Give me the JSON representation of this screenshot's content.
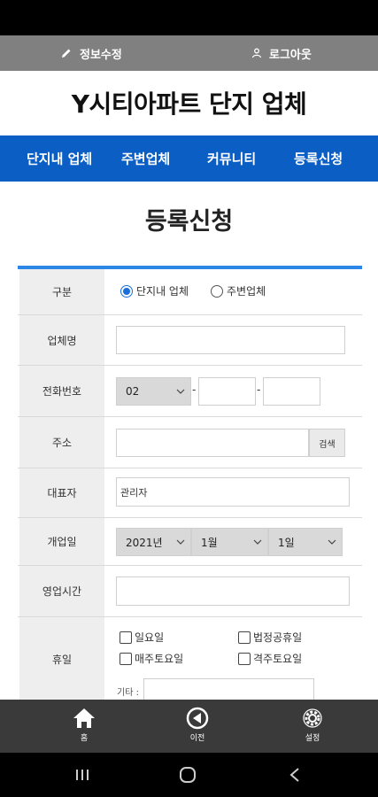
{
  "topbar": {
    "edit_label": "정보수정",
    "logout_label": "로그아웃"
  },
  "site": {
    "title": "Y시티아파트 단지 업체"
  },
  "nav": {
    "items": [
      {
        "label": "단지내 업체"
      },
      {
        "label": "주변업체"
      },
      {
        "label": "커뮤니티"
      },
      {
        "label": "등록신청"
      }
    ]
  },
  "page": {
    "title": "등록신청"
  },
  "form": {
    "category": {
      "label": "구분",
      "options": [
        "단지내 업체",
        "주변업체"
      ],
      "selected": "단지내 업체"
    },
    "company_name": {
      "label": "업체명",
      "value": ""
    },
    "phone": {
      "label": "전화번호",
      "area_code": "02",
      "mid": "",
      "last": "",
      "separator": "-"
    },
    "address": {
      "label": "주소",
      "value": "",
      "search_label": "검색"
    },
    "representative": {
      "label": "대표자",
      "value": "관리자"
    },
    "open_date": {
      "label": "개업일",
      "year": "2021년",
      "month": "1월",
      "day": "1일"
    },
    "business_hours": {
      "label": "영업시간",
      "value": ""
    },
    "holiday": {
      "label": "휴일",
      "options": [
        "일요일",
        "법정공휴일",
        "매주토요일",
        "격주토요일"
      ],
      "other_label": "기타 :",
      "other_value": ""
    }
  },
  "bottom_nav": {
    "items": [
      {
        "label": "홈",
        "icon": "home-icon"
      },
      {
        "label": "이전",
        "icon": "back-icon"
      },
      {
        "label": "설정",
        "icon": "settings-icon"
      }
    ]
  },
  "colors": {
    "nav_bg": "#0a5ec4",
    "accent": "#2b86e6",
    "topbar_bg": "#808080",
    "bottom_nav_bg": "#3a3a3a"
  }
}
